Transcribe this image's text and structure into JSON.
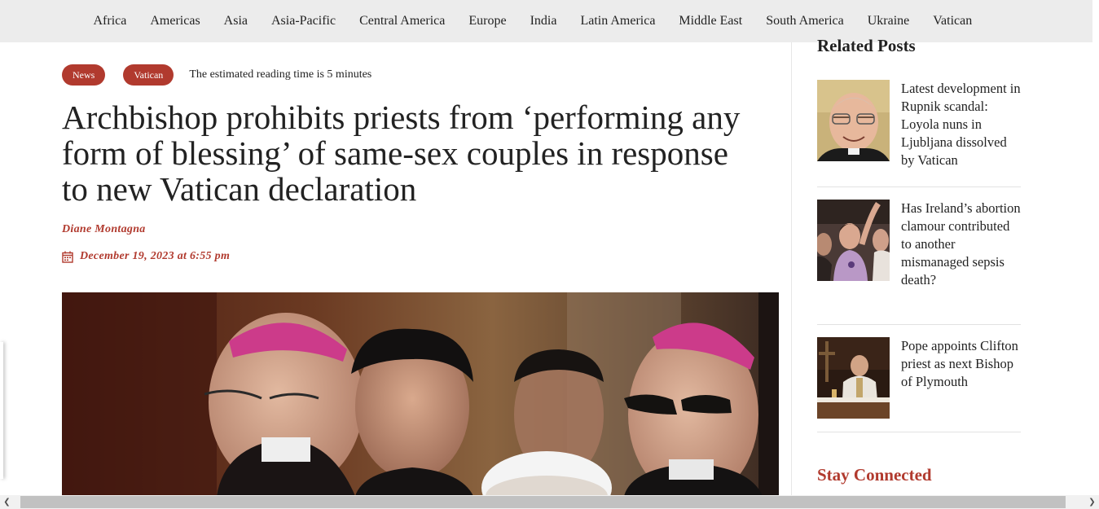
{
  "nav": {
    "items": [
      "Africa",
      "Americas",
      "Asia",
      "Asia-Pacific",
      "Central America",
      "Europe",
      "India",
      "Latin America",
      "Middle East",
      "South America",
      "Ukraine",
      "Vatican"
    ]
  },
  "article": {
    "tags": [
      "News",
      "Vatican"
    ],
    "reading_time": "The estimated reading time is 5 minutes",
    "headline": "Archbishop prohibits priests from ‘performing any form of blessing’ of same-sex couples in response to new Vatican declaration",
    "author": "Diane Montagna",
    "date": "December 19, 2023 at 6:55 pm",
    "hero_icon": "photo-of-bishops-icon"
  },
  "sidebar": {
    "related_title": "Related Posts",
    "posts": [
      {
        "title": "Latest development in Rupnik scandal: Loyola nuns in Ljubljana dissolved by Vatican"
      },
      {
        "title": "Has Ireland’s abortion clamour contributed to another mismanaged sepsis death?"
      },
      {
        "title": "Pope appoints Clifton priest as next Bishop of Plymouth"
      }
    ],
    "stay_connected": "Stay Connected"
  },
  "colors": {
    "accent": "#b13a2e",
    "nav_bg": "#ececec"
  }
}
